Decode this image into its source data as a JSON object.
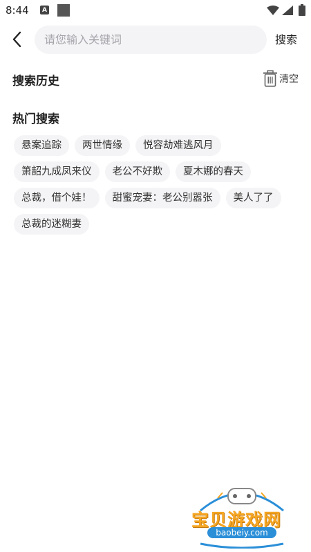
{
  "status_bar": {
    "time": "8:44",
    "notification_letter": "A"
  },
  "search": {
    "placeholder": "请您输入关键词",
    "value": "",
    "button_label": "搜索"
  },
  "history": {
    "title": "搜索历史",
    "clear_label": "清空"
  },
  "hot": {
    "title": "热门搜索",
    "tags": [
      "悬案追踪",
      "两世情缘",
      "悦容劫难逃风月",
      "箫韶九成凤来仪",
      "老公不好欺",
      "夏木娜的春天",
      "总裁，借个娃！",
      "甜蜜宠妻：老公别嚣张",
      "美人了了",
      "总裁的迷糊妻"
    ]
  },
  "watermark": {
    "title": "宝贝游戏网",
    "url": "baobeiy.com"
  },
  "colors": {
    "accent_orange": "#f5a623",
    "tag_bg": "#f4f4f6",
    "watermark_blue": "#2b8fd8"
  },
  "icons": [
    "back-arrow-icon",
    "trash-icon",
    "wifi-icon",
    "signal-icon",
    "battery-icon"
  ]
}
